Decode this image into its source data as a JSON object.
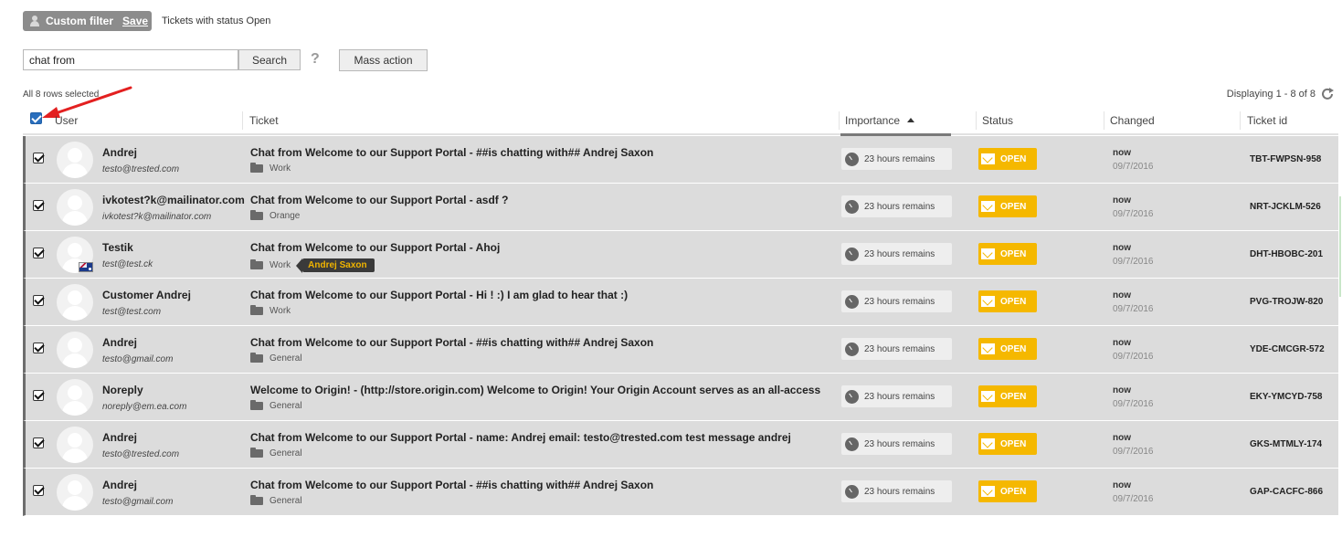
{
  "filter": {
    "label": "Custom filter",
    "save_label": "Save",
    "description": "Tickets with status Open"
  },
  "search": {
    "value": "chat from",
    "button_label": "Search",
    "help_label": "?"
  },
  "toolbar": {
    "mass_action_label": "Mass action"
  },
  "selection": {
    "rows_selected_label": "All 8 rows selected"
  },
  "pagination": {
    "displaying_label": "Displaying 1 - 8 of 8"
  },
  "colors": {
    "status_open": "#f5b800",
    "row_background": "#dcdcdc",
    "annotation_arrow": "#e32020"
  },
  "columns": {
    "user": "User",
    "ticket": "Ticket",
    "importance": "Importance",
    "status": "Status",
    "changed": "Changed",
    "ticket_id": "Ticket id"
  },
  "rows": [
    {
      "name": "Andrej",
      "email": "testo@trested.com",
      "subject": "Chat from Welcome to our Support Portal - ##is chatting with## Andrej Saxon",
      "department": "Work",
      "importance": "23 hours remains",
      "status": "OPEN",
      "changed": "now",
      "changed_date": "09/7/2016",
      "ticket_id": "TBT-FWPSN-958"
    },
    {
      "name": "ivkotest?k@mailinator.com",
      "email": "ivkotest?k@mailinator.com",
      "subject": "Chat from Welcome to our Support Portal - asdf ?",
      "department": "Orange",
      "importance": "23 hours remains",
      "status": "OPEN",
      "changed": "now",
      "changed_date": "09/7/2016",
      "ticket_id": "NRT-JCKLM-526"
    },
    {
      "name": "Testik",
      "email": "test@test.ck",
      "subject": "Chat from Welcome to our Support Portal - Ahoj",
      "department": "Work",
      "agent": "Andrej Saxon",
      "importance": "23 hours remains",
      "status": "OPEN",
      "changed": "now",
      "changed_date": "09/7/2016",
      "ticket_id": "DHT-HBOBC-201"
    },
    {
      "name": "Customer Andrej",
      "email": "test@test.com",
      "subject": "Chat from Welcome to our Support Portal - Hi ! :) I am glad to hear that :)",
      "department": "Work",
      "importance": "23 hours remains",
      "status": "OPEN",
      "changed": "now",
      "changed_date": "09/7/2016",
      "ticket_id": "PVG-TROJW-820"
    },
    {
      "name": "Andrej",
      "email": "testo@gmail.com",
      "subject": "Chat from Welcome to our Support Portal - ##is chatting with## Andrej Saxon",
      "department": "General",
      "importance": "23 hours remains",
      "status": "OPEN",
      "changed": "now",
      "changed_date": "09/7/2016",
      "ticket_id": "YDE-CMCGR-572"
    },
    {
      "name": "Noreply",
      "email": "noreply@em.ea.com",
      "subject": "Welcome to Origin! - (http://store.origin.com) Welcome to Origin! Your Origin Account serves as an all-access",
      "department": "General",
      "importance": "23 hours remains",
      "status": "OPEN",
      "changed": "now",
      "changed_date": "09/7/2016",
      "ticket_id": "EKY-YMCYD-758"
    },
    {
      "name": "Andrej",
      "email": "testo@trested.com",
      "subject": "Chat from Welcome to our Support Portal - name: Andrej email: testo@trested.com test message andrej",
      "department": "General",
      "importance": "23 hours remains",
      "status": "OPEN",
      "changed": "now",
      "changed_date": "09/7/2016",
      "ticket_id": "GKS-MTMLY-174"
    },
    {
      "name": "Andrej",
      "email": "testo@gmail.com",
      "subject": "Chat from Welcome to our Support Portal - ##is chatting with## Andrej Saxon",
      "department": "General",
      "importance": "23 hours remains",
      "status": "OPEN",
      "changed": "now",
      "changed_date": "09/7/2016",
      "ticket_id": "GAP-CACFC-866"
    }
  ]
}
